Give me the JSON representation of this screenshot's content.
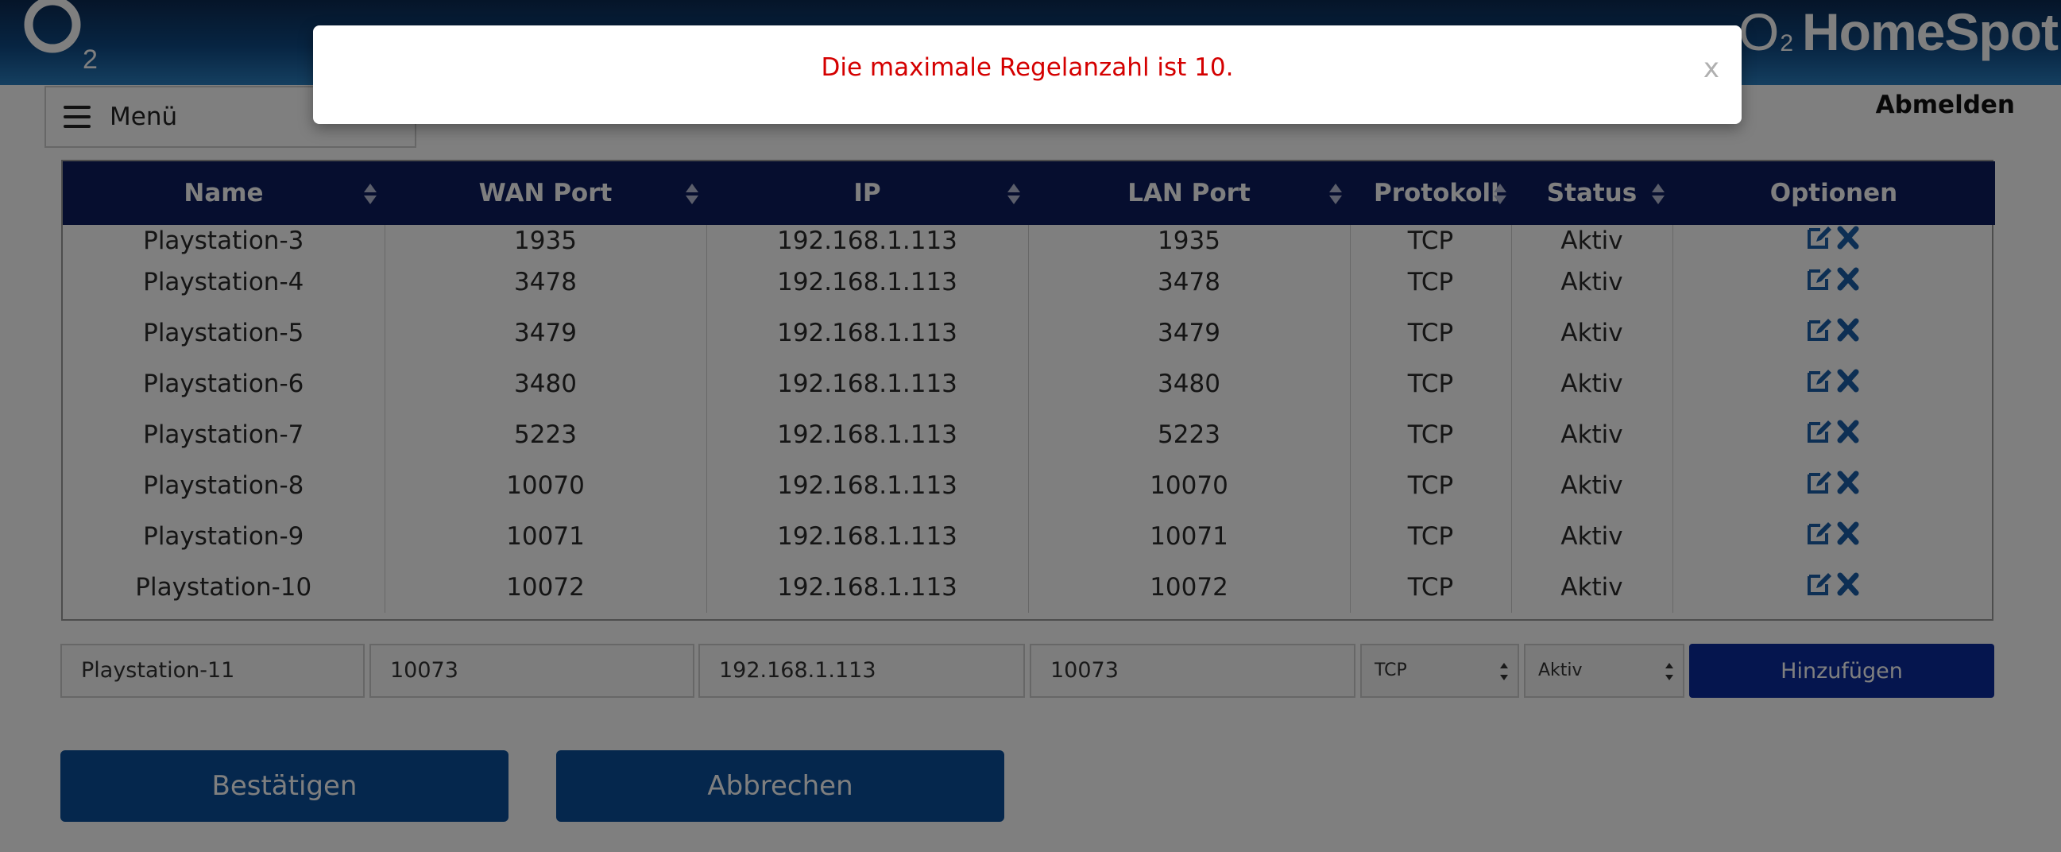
{
  "header": {
    "brand_name": "HomeSpot",
    "brand_prefix": "O",
    "brand_sub": "2"
  },
  "menu": {
    "label": "Menü"
  },
  "logout_label": "Abmelden",
  "table": {
    "columns": [
      "Name",
      "WAN Port",
      "IP",
      "LAN Port",
      "Protokoll",
      "Status",
      "Optionen"
    ],
    "rows": [
      {
        "name": "Playstation-3",
        "wan": "1935",
        "ip": "192.168.1.113",
        "lan": "1935",
        "proto": "TCP",
        "status": "Aktiv"
      },
      {
        "name": "Playstation-4",
        "wan": "3478",
        "ip": "192.168.1.113",
        "lan": "3478",
        "proto": "TCP",
        "status": "Aktiv"
      },
      {
        "name": "Playstation-5",
        "wan": "3479",
        "ip": "192.168.1.113",
        "lan": "3479",
        "proto": "TCP",
        "status": "Aktiv"
      },
      {
        "name": "Playstation-6",
        "wan": "3480",
        "ip": "192.168.1.113",
        "lan": "3480",
        "proto": "TCP",
        "status": "Aktiv"
      },
      {
        "name": "Playstation-7",
        "wan": "5223",
        "ip": "192.168.1.113",
        "lan": "5223",
        "proto": "TCP",
        "status": "Aktiv"
      },
      {
        "name": "Playstation-8",
        "wan": "10070",
        "ip": "192.168.1.113",
        "lan": "10070",
        "proto": "TCP",
        "status": "Aktiv"
      },
      {
        "name": "Playstation-9",
        "wan": "10071",
        "ip": "192.168.1.113",
        "lan": "10071",
        "proto": "TCP",
        "status": "Aktiv"
      },
      {
        "name": "Playstation-10",
        "wan": "10072",
        "ip": "192.168.1.113",
        "lan": "10072",
        "proto": "TCP",
        "status": "Aktiv"
      }
    ],
    "option_icons": [
      "edit-icon",
      "delete-icon"
    ]
  },
  "new_rule": {
    "name": "Playstation-11",
    "wan": "10073",
    "ip": "192.168.1.113",
    "lan": "10073",
    "proto": "TCP",
    "status": "Aktiv",
    "add_label": "Hinzufügen"
  },
  "actions": {
    "confirm_label": "Bestätigen",
    "cancel_label": "Abbrechen"
  },
  "modal": {
    "message": "Die maximale Regelanzahl ist 10.",
    "close_label": "x"
  },
  "colors": {
    "header_bar": "#0f4a85",
    "table_header": "#0d1d5e",
    "add_button": "#0a2a9c",
    "primary_button": "#0a4f9a",
    "error_text": "#d40000",
    "icon_blue": "#1a5fa8"
  }
}
